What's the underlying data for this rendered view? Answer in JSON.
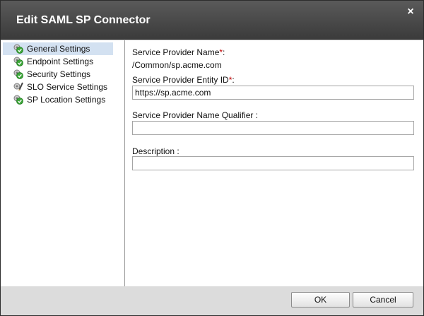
{
  "dialog": {
    "title": "Edit SAML SP Connector",
    "close_glyph": "×"
  },
  "sidebar": {
    "items": [
      {
        "label": "General Settings",
        "icon": "check-gear-icon",
        "selected": true
      },
      {
        "label": "Endpoint Settings",
        "icon": "check-gear-icon",
        "selected": false
      },
      {
        "label": "Security Settings",
        "icon": "check-gear-icon",
        "selected": false
      },
      {
        "label": "SLO Service Settings",
        "icon": "pencil-gear-icon",
        "selected": false
      },
      {
        "label": "SP Location Settings",
        "icon": "check-gear-icon",
        "selected": false
      }
    ]
  },
  "form": {
    "sp_name": {
      "label": "Service Provider Name",
      "required_mark": "*",
      "suffix": ":",
      "value": "/Common/sp.acme.com"
    },
    "entity_id": {
      "label": "Service Provider Entity ID",
      "required_mark": "*",
      "suffix": ":",
      "value": "https://sp.acme.com"
    },
    "name_qualifier": {
      "label": "Service Provider Name Qualifier :",
      "value": ""
    },
    "description": {
      "label": "Description :",
      "value": ""
    }
  },
  "footer": {
    "ok_label": "OK",
    "cancel_label": "Cancel"
  },
  "colors": {
    "titlebar": "#4a4a4a",
    "selected_row": "#d3e1f1",
    "required": "#c00000",
    "check_green": "#3da63a"
  }
}
